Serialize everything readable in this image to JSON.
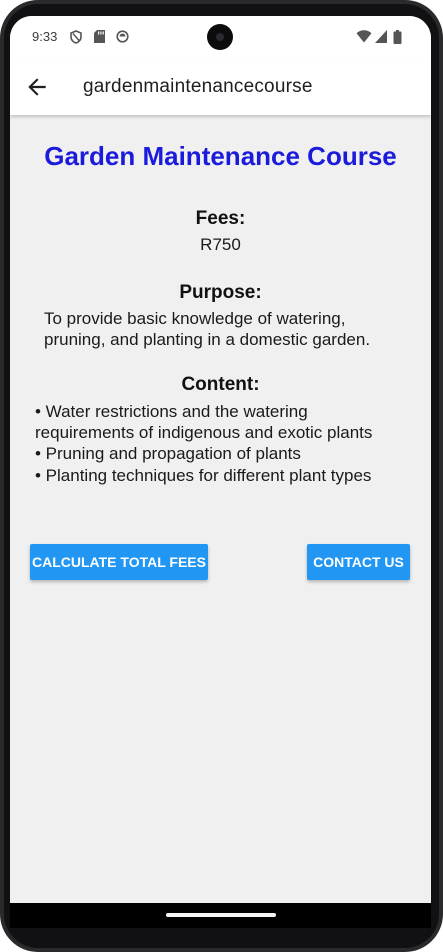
{
  "status_bar": {
    "time": "9:33",
    "icons": [
      "shield-icon",
      "sd-card-icon",
      "sync-icon",
      "wifi-icon",
      "cellular-icon",
      "battery-icon"
    ]
  },
  "app_bar": {
    "back_icon": "arrow-back-icon",
    "title": "gardenmaintenancecourse"
  },
  "course": {
    "title": "Garden Maintenance Course",
    "fees_heading": "Fees:",
    "fees_value": "R750",
    "purpose_heading": "Purpose:",
    "purpose_lines": [
      "To provide basic knowledge of watering,",
      "pruning, and planting in a domestic garden."
    ],
    "content_heading": "Content:",
    "content_lines": [
      "• Water restrictions and the watering",
      "requirements of indigenous and exotic plants",
      "• Pruning and propagation of plants",
      "• Planting techniques for different plant types"
    ]
  },
  "buttons": {
    "calculate": "CALCULATE TOTAL FEES",
    "contact": "CONTACT US"
  },
  "colors": {
    "title": "#1b1bdc",
    "button": "#2196f3",
    "background": "#f0f0f0"
  }
}
